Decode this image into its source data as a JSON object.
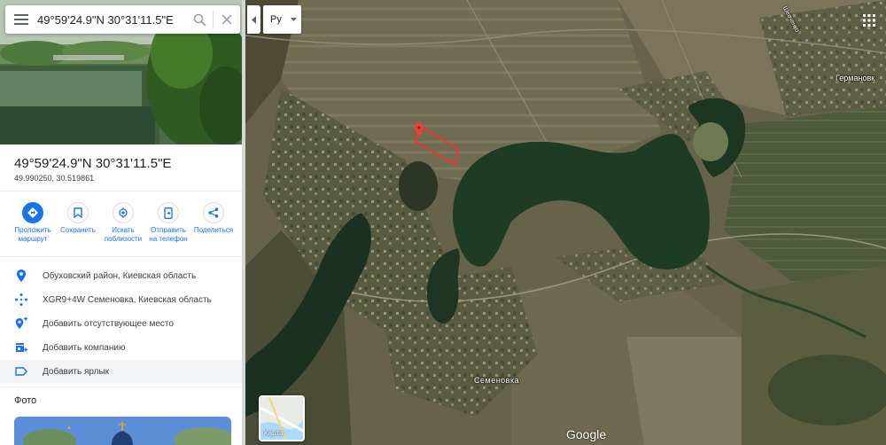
{
  "search": {
    "value": "49°59'24.9\"N 30°31'11.5\"E",
    "menu_icon": "menu-icon",
    "search_icon": "search-icon",
    "clear_icon": "close-icon"
  },
  "place": {
    "title": "49°59'24.9\"N 30°31'11.5\"E",
    "decimal": "49.990250, 30.519861"
  },
  "actions": [
    {
      "icon": "directions-icon",
      "label": "Проложить\nмаршрут",
      "primary": true
    },
    {
      "icon": "bookmark-icon",
      "label": "Сохранить",
      "primary": false
    },
    {
      "icon": "nearby-icon",
      "label": "Искать\nпоблизости",
      "primary": false
    },
    {
      "icon": "send-to-phone-icon",
      "label": "Отправить\nна телефон",
      "primary": false
    },
    {
      "icon": "share-icon",
      "label": "Поделиться",
      "primary": false
    }
  ],
  "info_rows": [
    {
      "icon": "location-pin-icon",
      "text": "Обуховский район, Киевская область"
    },
    {
      "icon": "plus-code-icon",
      "text": "XGR9+4W Семеновка, Киевская область"
    },
    {
      "icon": "add-place-icon",
      "text": "Добавить отсутствующее место"
    },
    {
      "icon": "add-business-icon",
      "text": "Добавить компанию"
    },
    {
      "icon": "label-icon",
      "text": "Добавить ярлык"
    }
  ],
  "photos": {
    "heading": "Фото"
  },
  "map": {
    "language_selector": "Ру",
    "labels": {
      "village_semenovka": "Семеновка",
      "village_germanovka": "Германовк",
      "road": "Шевченко"
    },
    "layer_toggle": "Карта",
    "attribution": "Google",
    "view": "satellite",
    "colors": {
      "accent": "#1a73e8",
      "marker": "#ea4335",
      "water": "#1e3b24"
    }
  }
}
